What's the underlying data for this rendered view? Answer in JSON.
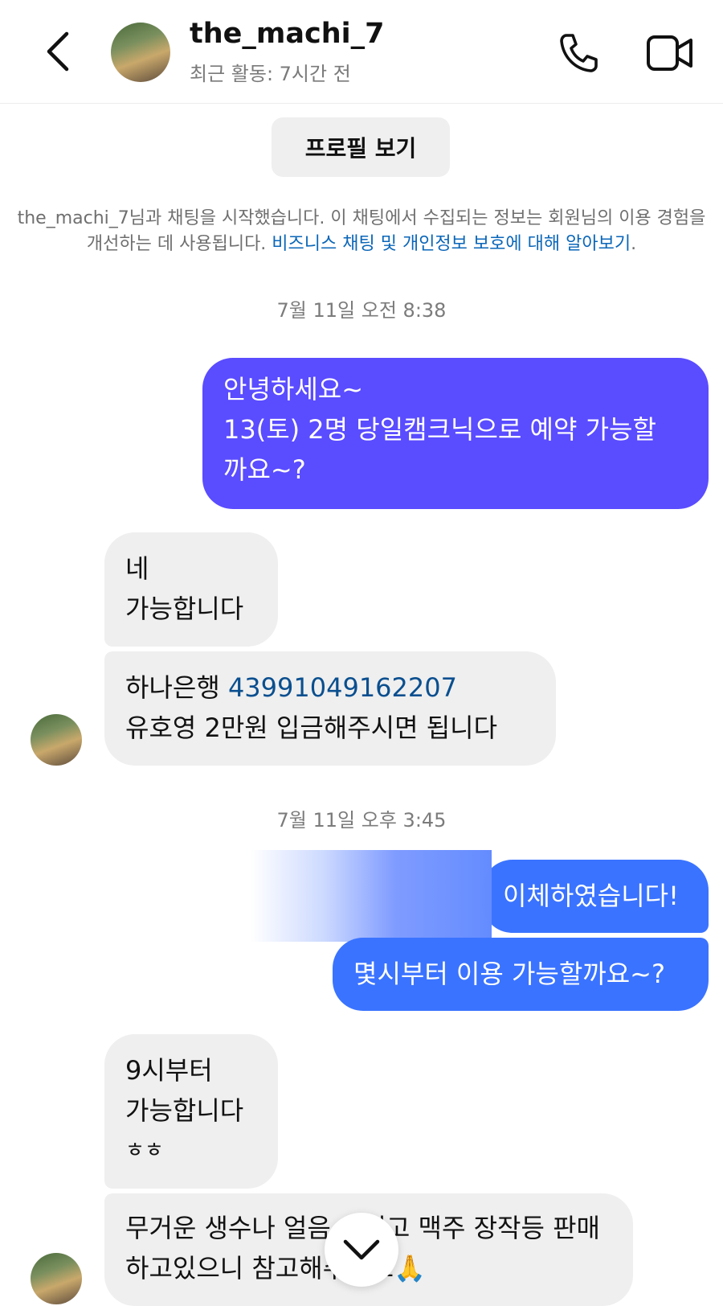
{
  "header": {
    "username": "the_machi_7",
    "status": "최근 활동: 7시간 전",
    "icons": {
      "back": "back-chevron-icon",
      "phone": "phone-icon",
      "video": "video-camera-icon"
    }
  },
  "profile_button": "프로필 보기",
  "notice": {
    "text": "the_machi_7님과 채팅을 시작했습니다. 이 채팅에서 수집되는 정보는 회원님의 이용 경험을 개선하는 데 사용됩니다. ",
    "link": "비즈니스 채팅 및 개인정보 보호에 대해 알아보기",
    "end": "."
  },
  "timestamps": [
    "7월 11일 오전 8:38",
    "7월 11일 오후 3:45"
  ],
  "messages": {
    "m1_l1": "안녕하세요~",
    "m1_l2": "13(토) 2명 당일캠크닉으로 예약 가능할",
    "m1_l3": "까요~?",
    "m2_l1": "네",
    "m2_l2": "가능합니다",
    "m3_bank": "하나은행 ",
    "m3_account": "43991049162207",
    "m3_l2": "유호영 2만원  입금해주시면 됩니다",
    "m4": "이체하였습니다!",
    "m5": "몇시부터 이용 가능할까요~?",
    "m6_l1": "9시부터",
    "m6_l2": "가능합니다",
    "m6_l3": "ㅎㅎ",
    "m7_l1": "무거운 생수나 얼음 그리고 맥주 장작등 판매",
    "m7_l2": "하고있으니 참고해주세요🙏"
  },
  "colors": {
    "outgoing_purple": "#5a4cff",
    "outgoing_blue": "#3a73ff",
    "incoming": "#efefef",
    "link": "#0a66b8"
  },
  "scroll_icon": "chevron-down-icon"
}
